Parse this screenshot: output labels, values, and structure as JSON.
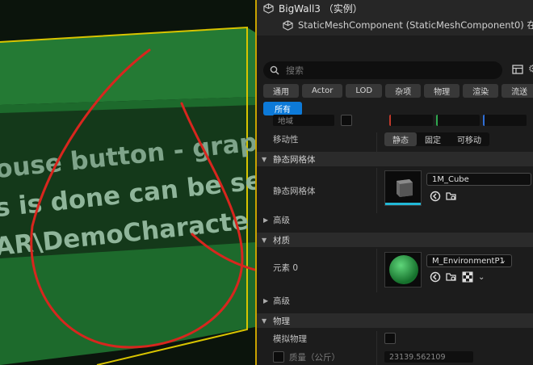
{
  "viewport": {
    "text_lines": [
      "ouse button - grap",
      "s is done can be se",
      "AR\\DemoCharacte"
    ]
  },
  "panel": {
    "actor_name": "BigWall3 （实例）",
    "component_label": "StaticMeshComponent (StaticMeshComponent0) 在",
    "search_placeholder": "搜索",
    "filters": [
      "通用",
      "Actor",
      "LOD",
      "杂项",
      "物理",
      "渲染",
      "流送"
    ],
    "active_filter": "所有",
    "partial_field_label": "地域",
    "mobility": {
      "label": "移动性",
      "options": [
        "静态",
        "固定",
        "可移动"
      ],
      "selected": "静态"
    },
    "section_static_mesh": "静态网格体",
    "static_mesh_label": "静态网格体",
    "static_mesh_asset": "1M_Cube",
    "advanced_1": "高级",
    "section_materials": "材质",
    "element_label": "元素 0",
    "material_asset": "M_EnvironmentP1",
    "advanced_2": "高级",
    "section_physics": "物理",
    "simulate_physics_label": "模拟物理",
    "mass_label": "质量（公斤）",
    "mass_value": "23139.562109"
  },
  "colors": {
    "accent": "#0d7ad8",
    "selection_border": "#c8a200",
    "wall_green": "#1d6a2c",
    "annotation_red": "#d8261e"
  }
}
